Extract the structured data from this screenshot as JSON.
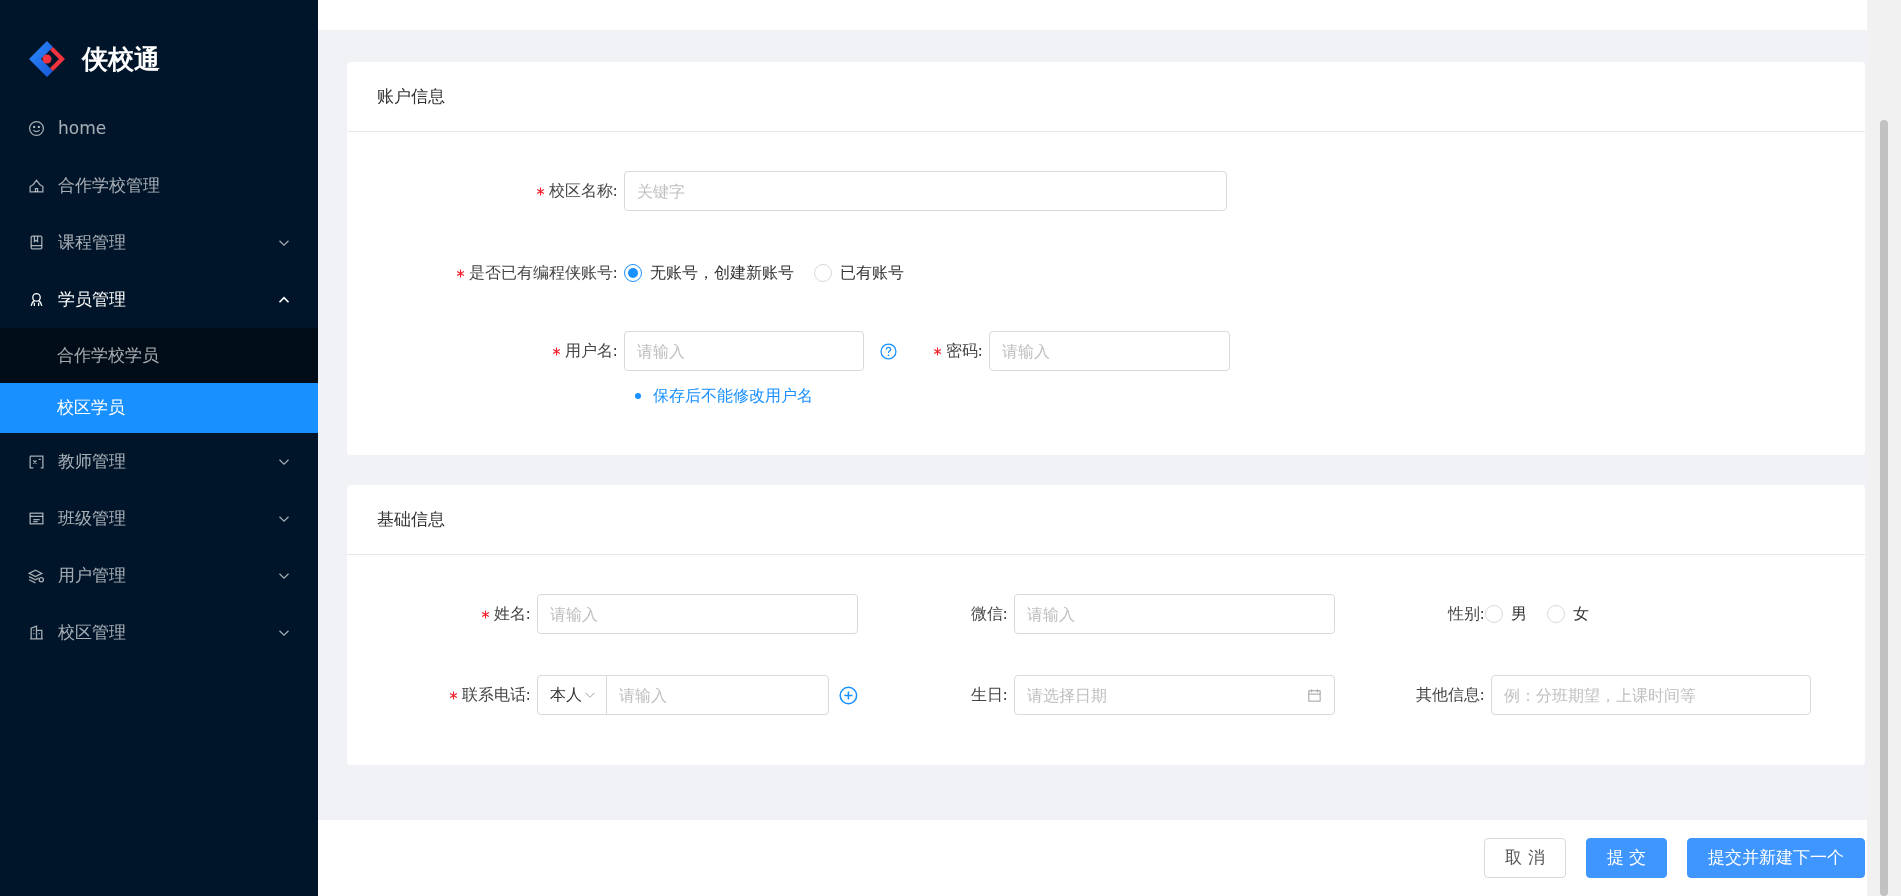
{
  "sidebar": {
    "logo": "侠校通",
    "items": [
      {
        "label": "home",
        "kind": "link"
      },
      {
        "label": "合作学校管理",
        "kind": "link"
      },
      {
        "label": "课程管理",
        "kind": "group",
        "expanded": false
      },
      {
        "label": "学员管理",
        "kind": "group",
        "expanded": true,
        "children": [
          {
            "label": "合作学校学员",
            "selected": false
          },
          {
            "label": "校区学员",
            "selected": true
          }
        ]
      },
      {
        "label": "教师管理",
        "kind": "group",
        "expanded": false
      },
      {
        "label": "班级管理",
        "kind": "group",
        "expanded": false
      },
      {
        "label": "用户管理",
        "kind": "group",
        "expanded": false
      },
      {
        "label": "校区管理",
        "kind": "group",
        "expanded": false
      }
    ]
  },
  "account_section": {
    "title": "账户信息",
    "campus_name": {
      "label": "校区名称:",
      "required": true,
      "placeholder": "关键字"
    },
    "has_account": {
      "label": "是否已有编程侠账号:",
      "required": true,
      "options": [
        {
          "label": "无账号，创建新账号",
          "selected": true
        },
        {
          "label": "已有账号",
          "selected": false
        }
      ]
    },
    "username": {
      "label": "用户名:",
      "required": true,
      "placeholder": "请输入"
    },
    "password": {
      "label": "密码:",
      "required": true,
      "placeholder": "请输入"
    },
    "hint": "保存后不能修改用户名"
  },
  "basic_section": {
    "title": "基础信息",
    "fields": [
      {
        "kind": "input",
        "label": "姓名:",
        "required": true,
        "placeholder": "请输入"
      },
      {
        "kind": "input",
        "label": "微信:",
        "required": false,
        "placeholder": "请输入"
      },
      {
        "kind": "radio",
        "label": "性别:",
        "required": false,
        "options": [
          {
            "label": "男",
            "selected": false
          },
          {
            "label": "女",
            "selected": false
          }
        ]
      },
      {
        "kind": "phone",
        "label": "联系电话:",
        "required": true,
        "relation": "本人",
        "placeholder": "请输入"
      },
      {
        "kind": "date",
        "label": "生日:",
        "required": false,
        "placeholder": "请选择日期"
      },
      {
        "kind": "input",
        "label": "其他信息:",
        "required": false,
        "placeholder": "例：分班期望，上课时间等"
      }
    ]
  },
  "footer_buttons": [
    {
      "label": "取 消",
      "kind": "default"
    },
    {
      "label": "提 交",
      "kind": "primary"
    },
    {
      "label": "提交并新建下一个",
      "kind": "primary"
    }
  ]
}
